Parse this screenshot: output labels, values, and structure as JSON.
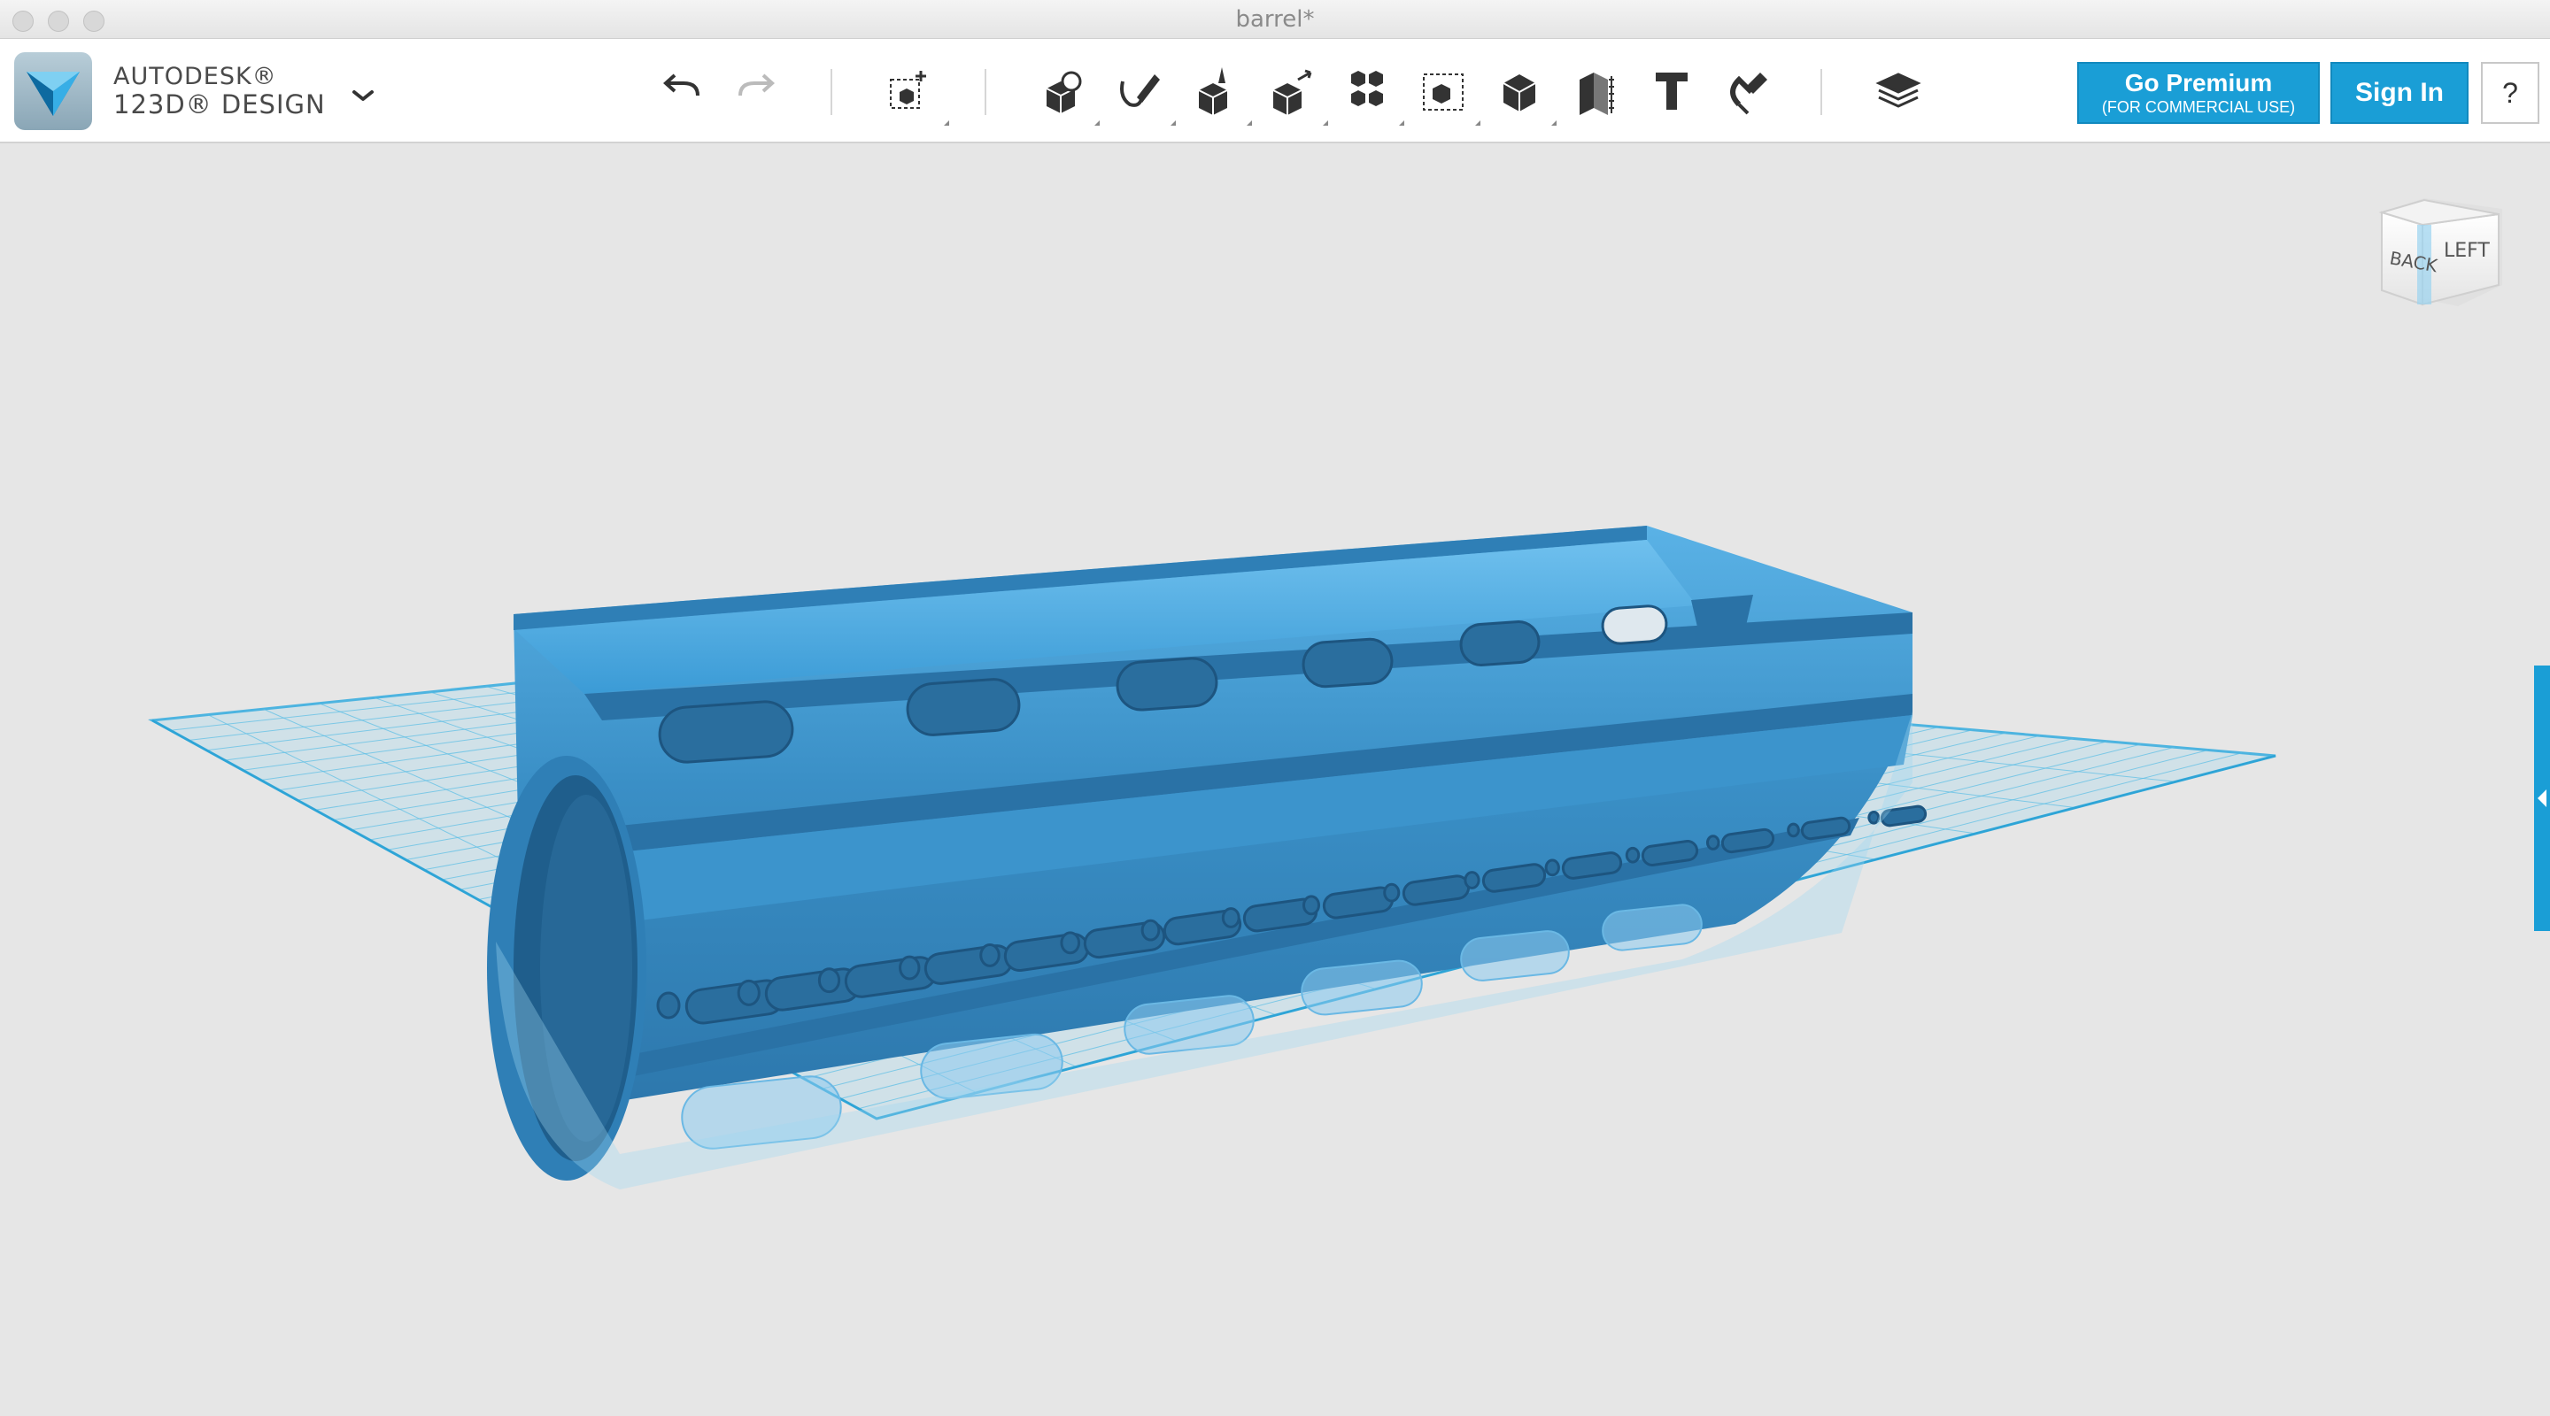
{
  "window": {
    "title": "barrel*"
  },
  "app": {
    "brand_line1": "AUTODESK®",
    "brand_line2": "123D® DESIGN"
  },
  "toolbar": {
    "tools": [
      {
        "name": "undo-icon"
      },
      {
        "name": "redo-icon"
      },
      {
        "name": "transform-icon"
      },
      {
        "name": "primitives-icon"
      },
      {
        "name": "sketch-icon"
      },
      {
        "name": "construct-icon"
      },
      {
        "name": "modify-icon"
      },
      {
        "name": "pattern-icon"
      },
      {
        "name": "group-icon"
      },
      {
        "name": "combine-icon"
      },
      {
        "name": "measure-icon"
      },
      {
        "name": "text-icon"
      },
      {
        "name": "snap-icon"
      },
      {
        "name": "materials-icon"
      }
    ]
  },
  "premium": {
    "line1": "Go Premium",
    "line2": "(FOR COMMERCIAL USE)"
  },
  "signin": "Sign In",
  "help": "?",
  "viewcube": {
    "left_label": "BACK",
    "right_label": "LEFT"
  },
  "colors": {
    "accent": "#1a9ed6",
    "model": "#3b8fc4",
    "grid": "#6ec6ea"
  }
}
